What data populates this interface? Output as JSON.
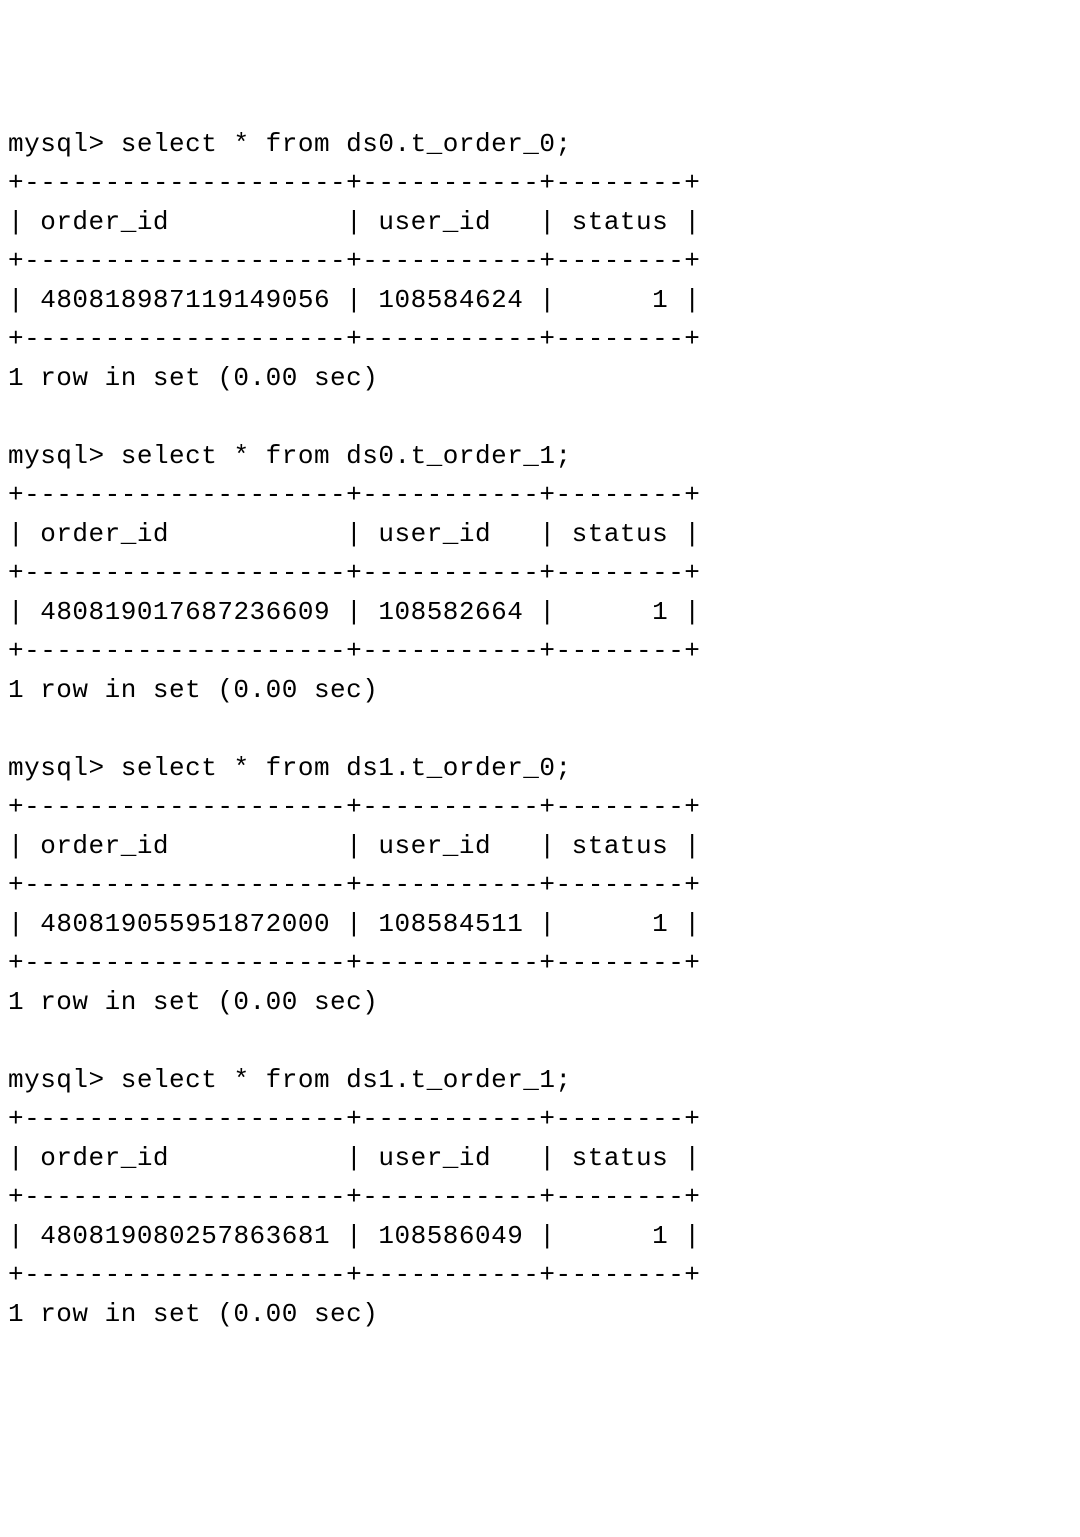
{
  "prompt": "mysql>",
  "queries": [
    {
      "command": "select * from ds0.t_order_0;",
      "columns": [
        "order_id",
        "user_id",
        "status"
      ],
      "row": {
        "order_id": "480818987119149056",
        "user_id": "108584624",
        "status": "1"
      },
      "footer": "1 row in set (0.00 sec)"
    },
    {
      "command": "select * from ds0.t_order_1;",
      "columns": [
        "order_id",
        "user_id",
        "status"
      ],
      "row": {
        "order_id": "480819017687236609",
        "user_id": "108582664",
        "status": "1"
      },
      "footer": "1 row in set (0.00 sec)"
    },
    {
      "command": "select * from ds1.t_order_0;",
      "columns": [
        "order_id",
        "user_id",
        "status"
      ],
      "row": {
        "order_id": "480819055951872000",
        "user_id": "108584511",
        "status": "1"
      },
      "footer": "1 row in set (0.00 sec)"
    },
    {
      "command": "select * from ds1.t_order_1;",
      "columns": [
        "order_id",
        "user_id",
        "status"
      ],
      "row": {
        "order_id": "480819080257863681",
        "user_id": "108586049",
        "status": "1"
      },
      "footer": "1 row in set (0.00 sec)"
    }
  ],
  "border": "+--------------------+-----------+--------+",
  "chart_data": {
    "type": "table",
    "tables": [
      {
        "name": "ds0.t_order_0",
        "columns": [
          "order_id",
          "user_id",
          "status"
        ],
        "rows": [
          [
            "480818987119149056",
            "108584624",
            "1"
          ]
        ]
      },
      {
        "name": "ds0.t_order_1",
        "columns": [
          "order_id",
          "user_id",
          "status"
        ],
        "rows": [
          [
            "480819017687236609",
            "108582664",
            "1"
          ]
        ]
      },
      {
        "name": "ds1.t_order_0",
        "columns": [
          "order_id",
          "user_id",
          "status"
        ],
        "rows": [
          [
            "480819055951872000",
            "108584511",
            "1"
          ]
        ]
      },
      {
        "name": "ds1.t_order_1",
        "columns": [
          "order_id",
          "user_id",
          "status"
        ],
        "rows": [
          [
            "480819080257863681",
            "108586049",
            "1"
          ]
        ]
      }
    ]
  }
}
